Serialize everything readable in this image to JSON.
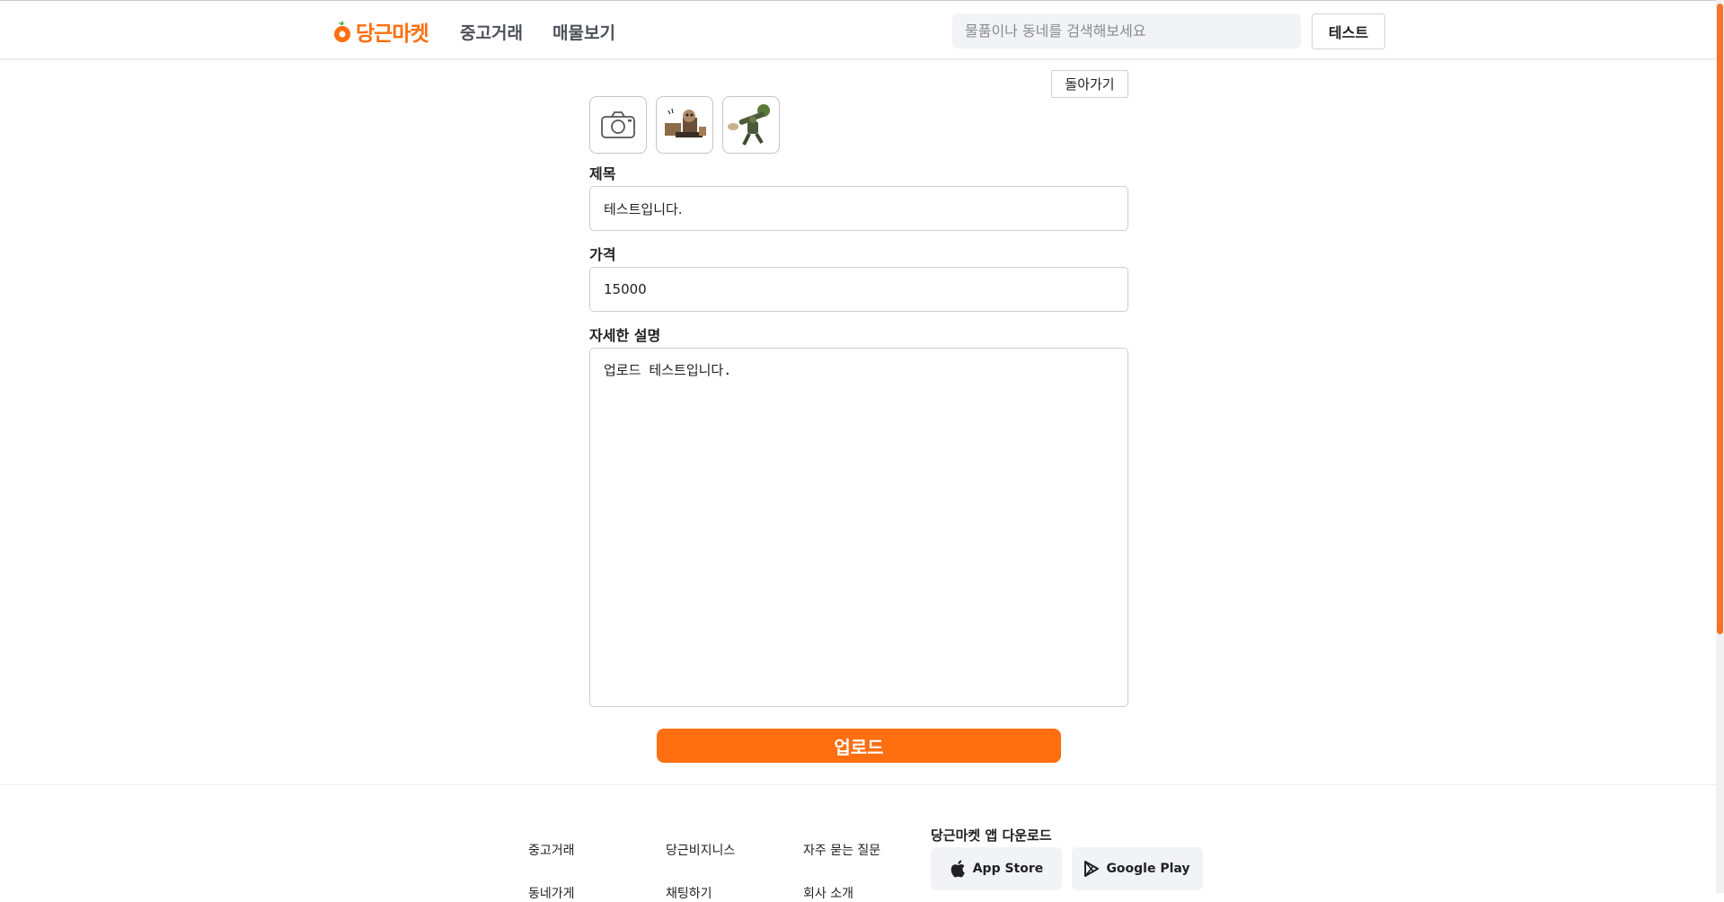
{
  "header": {
    "logo_text": "당근마켓",
    "nav": [
      "중고거래",
      "매물보기"
    ],
    "search_placeholder": "물품이나 동네를 검색해보세요",
    "user_label": "테스트"
  },
  "form": {
    "back_label": "돌아가기",
    "title_label": "제목",
    "title_value": "테스트입니다.",
    "price_label": "가격",
    "price_value": "15000",
    "desc_label": "자세한 설명",
    "desc_value": "업로드 테스트입니다.",
    "upload_label": "업로드",
    "images": [
      "camera-icon",
      "uploaded-image-1",
      "uploaded-image-2"
    ]
  },
  "footer": {
    "links": [
      "중고거래",
      "당근비지니스",
      "자주 묻는 질문",
      "동네가게",
      "채팅하기",
      "회사 소개"
    ],
    "app_download_title": "당근마켓 앱 다운로드",
    "app_store": "App Store",
    "google_play": "Google Play"
  },
  "colors": {
    "brand": "#ff6f0f",
    "border": "#cfcfcf",
    "search_bg": "#f2f3f6"
  }
}
